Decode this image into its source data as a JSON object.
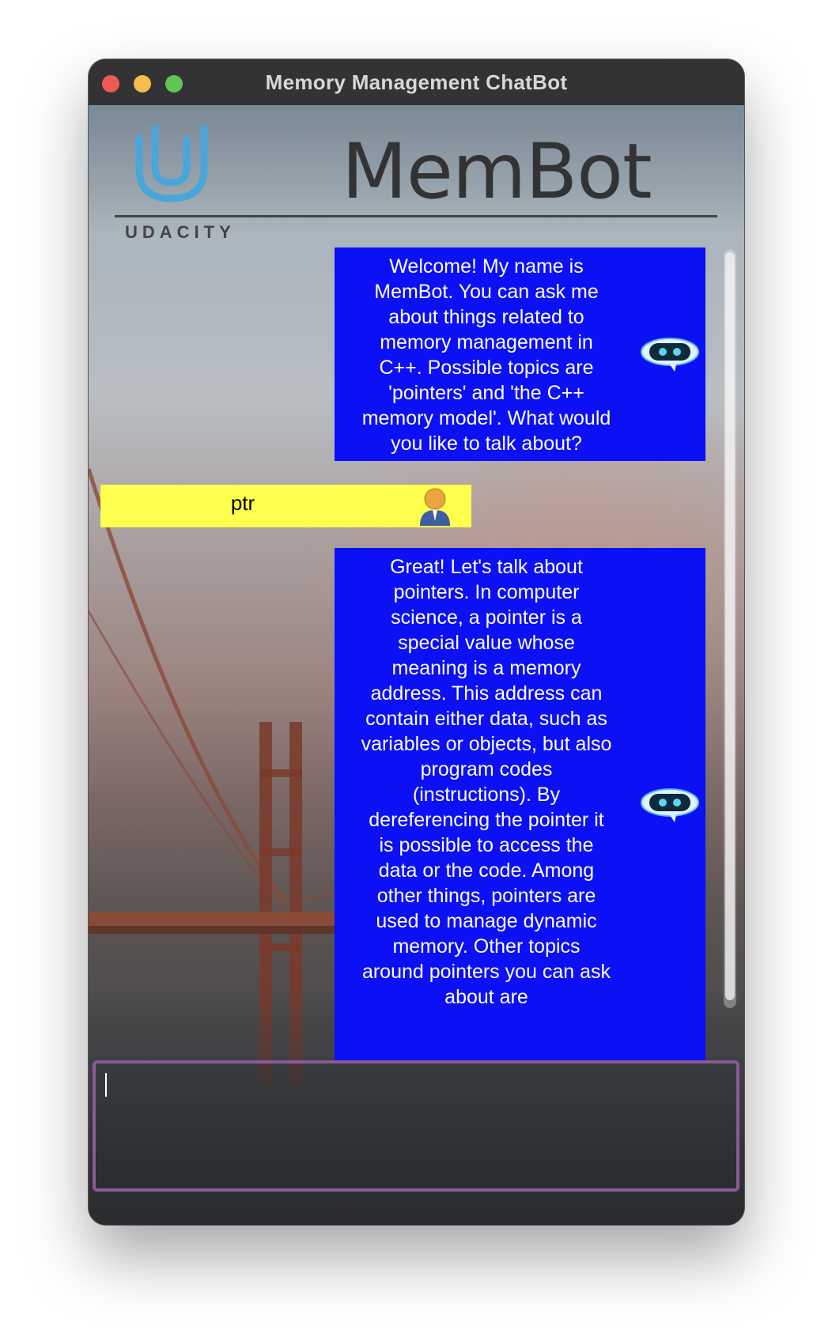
{
  "window": {
    "title": "Memory Management ChatBot"
  },
  "header": {
    "brand_text": "UDACITY",
    "app_title": "MemBot"
  },
  "messages": [
    {
      "sender": "bot",
      "text": "Welcome! My name is MemBot. You can ask me about things related to memory management in C++. Possible topics are 'pointers' and 'the C++ memory model'. What would you like to talk about?",
      "avatar_icon": "robot-icon"
    },
    {
      "sender": "user",
      "text": "ptr",
      "avatar_icon": "user-icon"
    },
    {
      "sender": "bot",
      "text": "Great! Let's talk about pointers. In computer science, a pointer is a special value whose meaning is a memory address. This address can contain either data, such as variables or objects, but also program codes (instructions). By dereferencing the pointer it is possible to access the data or the code. Among other things, pointers are used to manage dynamic memory. Other topics around pointers you can ask about are",
      "avatar_icon": "robot-icon"
    }
  ],
  "input": {
    "value": ""
  },
  "colors": {
    "bot_bubble": "#0b10f5",
    "user_bubble": "#ffff4d",
    "input_border": "#8a5b94",
    "udacity_blue": "#4aa5d9"
  }
}
